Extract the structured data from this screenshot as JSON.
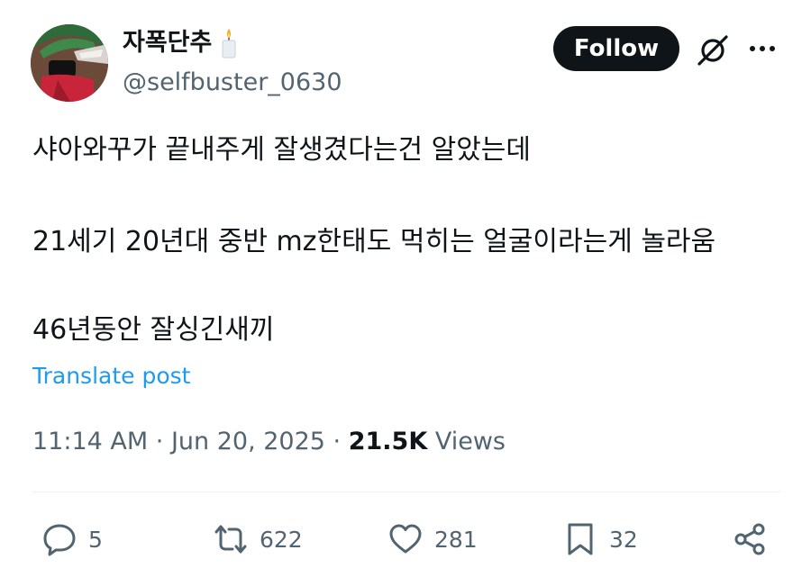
{
  "author": {
    "display_name": "자폭단추",
    "handle": "@selfbuster_0630"
  },
  "follow_label": "Follow",
  "tweet": {
    "lines": [
      "샤아와꾸가 끝내주게 잘생겼다는건 알았는데",
      "21세기 20년대 중반 mz한태도 먹히는 얼굴이라는게 놀라움",
      "46년동안 잘싱긴새끼"
    ]
  },
  "translate_label": "Translate post",
  "meta": {
    "time": "11:14 AM",
    "date": "Jun 20, 2025",
    "views_count": "21.5K",
    "views_label": "Views"
  },
  "actions": {
    "replies": "5",
    "reposts": "622",
    "likes": "281",
    "bookmarks": "32"
  },
  "icons": [
    "candle-emoji-icon",
    "grok-icon",
    "more-icon",
    "reply-icon",
    "repost-icon",
    "like-icon",
    "bookmark-icon",
    "share-icon"
  ],
  "colors": {
    "text": "#0f1419",
    "secondary": "#536471",
    "link": "#1d9bf0",
    "follow_bg": "#0f1419"
  }
}
